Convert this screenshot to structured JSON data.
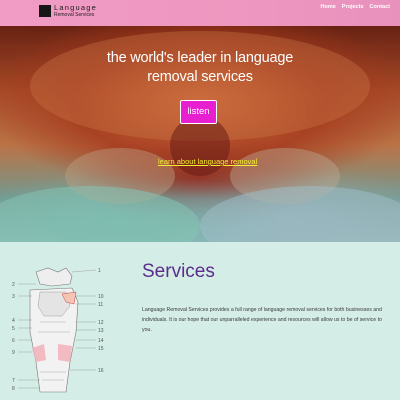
{
  "navbar": {
    "brand_line1": "Language",
    "brand_line2": "Removal Services",
    "links": [
      "Home",
      "Projects",
      "Contact"
    ]
  },
  "hero": {
    "title": "the world's leader in language removal services",
    "listen_label": "listen",
    "learn_link": "learn about language removal"
  },
  "services": {
    "title": "Services",
    "description": "Language Removal Services provides a full range of language removal services for both businesses and individuals. It is our hope that our unparralleled experience and resources will allow us to be of service to you.",
    "diagram_labels": [
      "1",
      "2",
      "3",
      "4",
      "5",
      "6",
      "7",
      "8",
      "9",
      "10",
      "11",
      "12",
      "13",
      "14",
      "15",
      "16"
    ]
  },
  "colors": {
    "navbar": "#f09cc4",
    "listen_button": "#e81ed1",
    "link": "#f2ee2c",
    "services_title": "#5b2c8a",
    "services_bg": "#d4ede6"
  }
}
